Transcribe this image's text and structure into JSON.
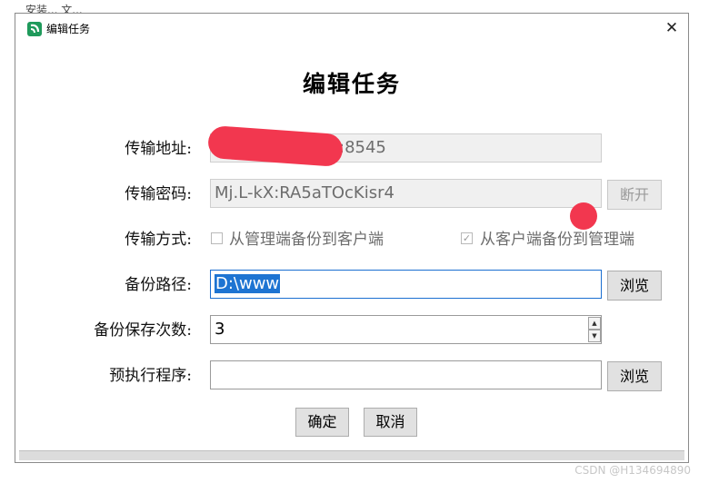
{
  "behind_window_text": "安装... 文...",
  "window": {
    "title": "编辑任务",
    "close_symbol": "✕"
  },
  "heading": "编辑任务",
  "form": {
    "address": {
      "label": "传输地址:",
      "value": ":8545"
    },
    "password": {
      "label": "传输密码:",
      "value": "Mj.L-kX:RA5aTOcKisr4",
      "disconnect_button": "断开"
    },
    "mode": {
      "label": "传输方式:",
      "option_server_to_client": "从管理端备份到客户端",
      "option_client_to_server": "从客户端备份到管理端"
    },
    "backup_path": {
      "label": "备份路径:",
      "value": "D:\\www",
      "browse_button": "浏览"
    },
    "retention": {
      "label": "备份保存次数:",
      "value": "3"
    },
    "pre_exec": {
      "label": "预执行程序:",
      "value": "",
      "browse_button": "浏览"
    }
  },
  "buttons": {
    "ok": "确定",
    "cancel": "取消"
  },
  "watermark": "CSDN @H134694890",
  "icons": {
    "app": "app-logo-icon",
    "close": "close-icon",
    "spin_up": "spin-up-icon",
    "spin_down": "spin-down-icon"
  },
  "colors": {
    "selection": "#1e74d2",
    "redaction": "#f2374f",
    "app_icon": "#1f9a5b"
  }
}
